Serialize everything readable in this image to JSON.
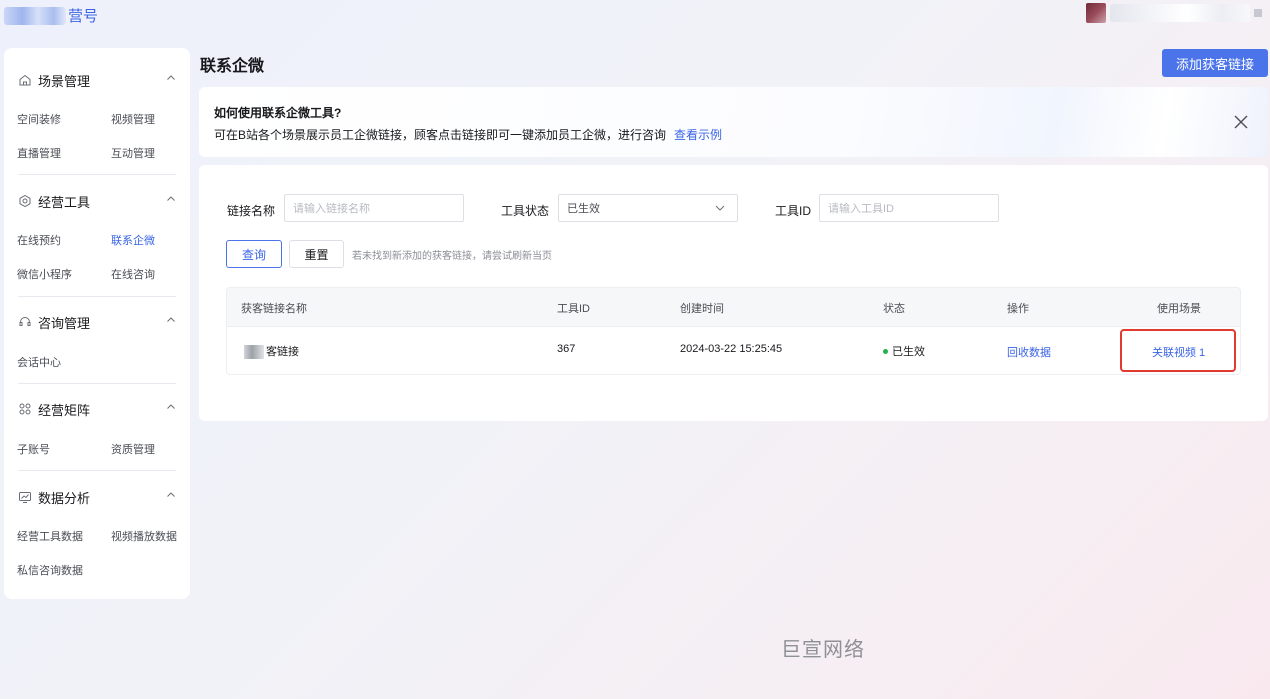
{
  "header": {
    "brand_suffix": "营号"
  },
  "sidebar": {
    "sections": [
      {
        "title": "场景管理",
        "icon": "home-icon",
        "items": [
          "空间装修",
          "视频管理",
          "直播管理",
          "互动管理"
        ]
      },
      {
        "title": "经营工具",
        "icon": "settings-icon",
        "items": [
          "在线预约",
          "联系企微",
          "微信小程序",
          "在线咨询"
        ]
      },
      {
        "title": "咨询管理",
        "icon": "headset-icon",
        "items": [
          "会话中心"
        ]
      },
      {
        "title": "经营矩阵",
        "icon": "grid-icon",
        "items": [
          "子账号",
          "资质管理"
        ]
      },
      {
        "title": "数据分析",
        "icon": "chart-icon",
        "items": [
          "经营工具数据",
          "视频播放数据",
          "私信咨询数据"
        ]
      }
    ],
    "active_item": "联系企微"
  },
  "main": {
    "title": "联系企微",
    "add_button": "添加获客链接",
    "banner": {
      "title": "如何使用联系企微工具?",
      "desc": "可在B站各个场景展示员工企微链接，顾客点击链接即可一键添加员工企微，进行咨询",
      "link": "查看示例"
    },
    "filters": {
      "name_label": "链接名称",
      "name_placeholder": "请输入链接名称",
      "status_label": "工具状态",
      "status_value": "已生效",
      "id_label": "工具ID",
      "id_placeholder": "请输入工具ID",
      "query_button": "查询",
      "reset_button": "重置",
      "hint": "若未找到新添加的获客链接，请尝试刷新当页"
    },
    "table": {
      "headers": [
        "获客链接名称",
        "工具ID",
        "创建时间",
        "状态",
        "操作",
        "使用场景"
      ],
      "rows": [
        {
          "name": "客链接",
          "id": "367",
          "created": "2024-03-22 15:25:45",
          "status": "已生效",
          "action": "回收数据",
          "scene": "关联视频 1"
        }
      ]
    }
  },
  "watermark": "巨宣网络",
  "colors": {
    "accent": "#4c74ea",
    "link": "#3a64e6",
    "highlight": "#e23a2e",
    "status_ok": "#22b04a"
  }
}
